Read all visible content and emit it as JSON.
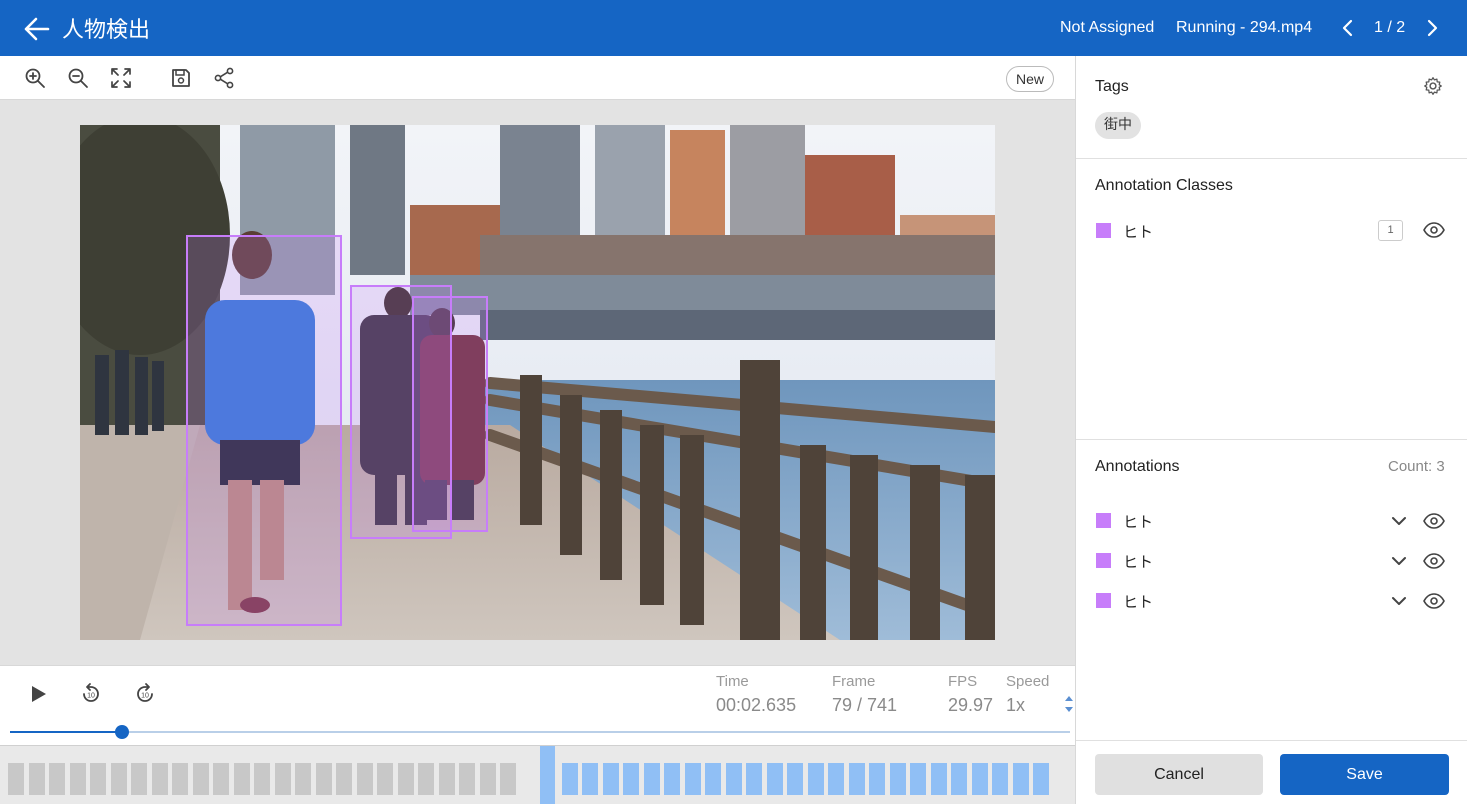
{
  "header": {
    "title": "人物検出",
    "assignee": "Not Assigned",
    "status": "Running - 294.mp4",
    "pager": "1 / 2"
  },
  "toolbar": {
    "icons": [
      "zoom-in-icon",
      "zoom-out-icon",
      "fullscreen-icon",
      "save-icon",
      "share-icon"
    ],
    "new_label": "New"
  },
  "player": {
    "time_label": "Time",
    "time_value": "00:02.635",
    "frame_label": "Frame",
    "frame_value": "79 / 741",
    "fps_label": "FPS",
    "fps_value": "29.97",
    "speed_label": "Speed",
    "speed_value": "1x",
    "progress_fraction": 0.107
  },
  "sidebar": {
    "tags_title": "Tags",
    "tags": [
      "街中"
    ],
    "classes_title": "Annotation Classes",
    "classes": [
      {
        "label": "ヒト",
        "count": "1",
        "color": "#c77dfa"
      }
    ],
    "annotations_title": "Annotations",
    "annotations_count": "Count: 3",
    "annotations": [
      {
        "label": "ヒト",
        "color": "#c77dfa"
      },
      {
        "label": "ヒト",
        "color": "#c77dfa"
      },
      {
        "label": "ヒト",
        "color": "#c77dfa"
      }
    ],
    "cancel_label": "Cancel",
    "save_label": "Save"
  },
  "colors": {
    "primary": "#1565c4",
    "annotation": "#c77dfa",
    "keyframe_active": "#90bff5",
    "keyframe_inactive": "#c8c8c8"
  }
}
